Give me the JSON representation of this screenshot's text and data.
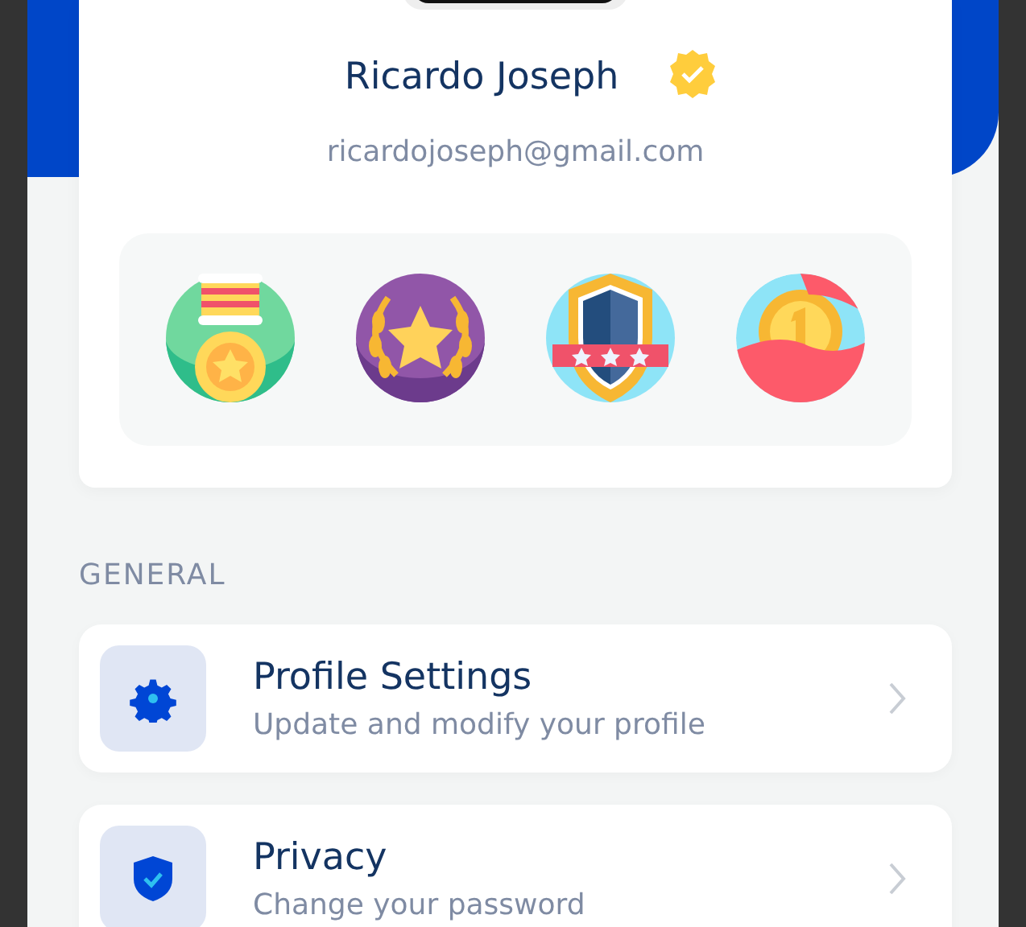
{
  "profile": {
    "name": "Ricardo Joseph",
    "verified": true,
    "email": "ricardojoseph@gmail.com"
  },
  "badges": [
    {
      "kind": "medal"
    },
    {
      "kind": "laurel"
    },
    {
      "kind": "shield"
    },
    {
      "kind": "coin"
    }
  ],
  "section": {
    "title": "GENERAL"
  },
  "menu_items": [
    {
      "kind": "settings",
      "title": "Profile Settings",
      "subtitle": "Update and modify your profile"
    },
    {
      "kind": "privacy",
      "title": "Privacy",
      "subtitle": "Change your password"
    }
  ]
}
